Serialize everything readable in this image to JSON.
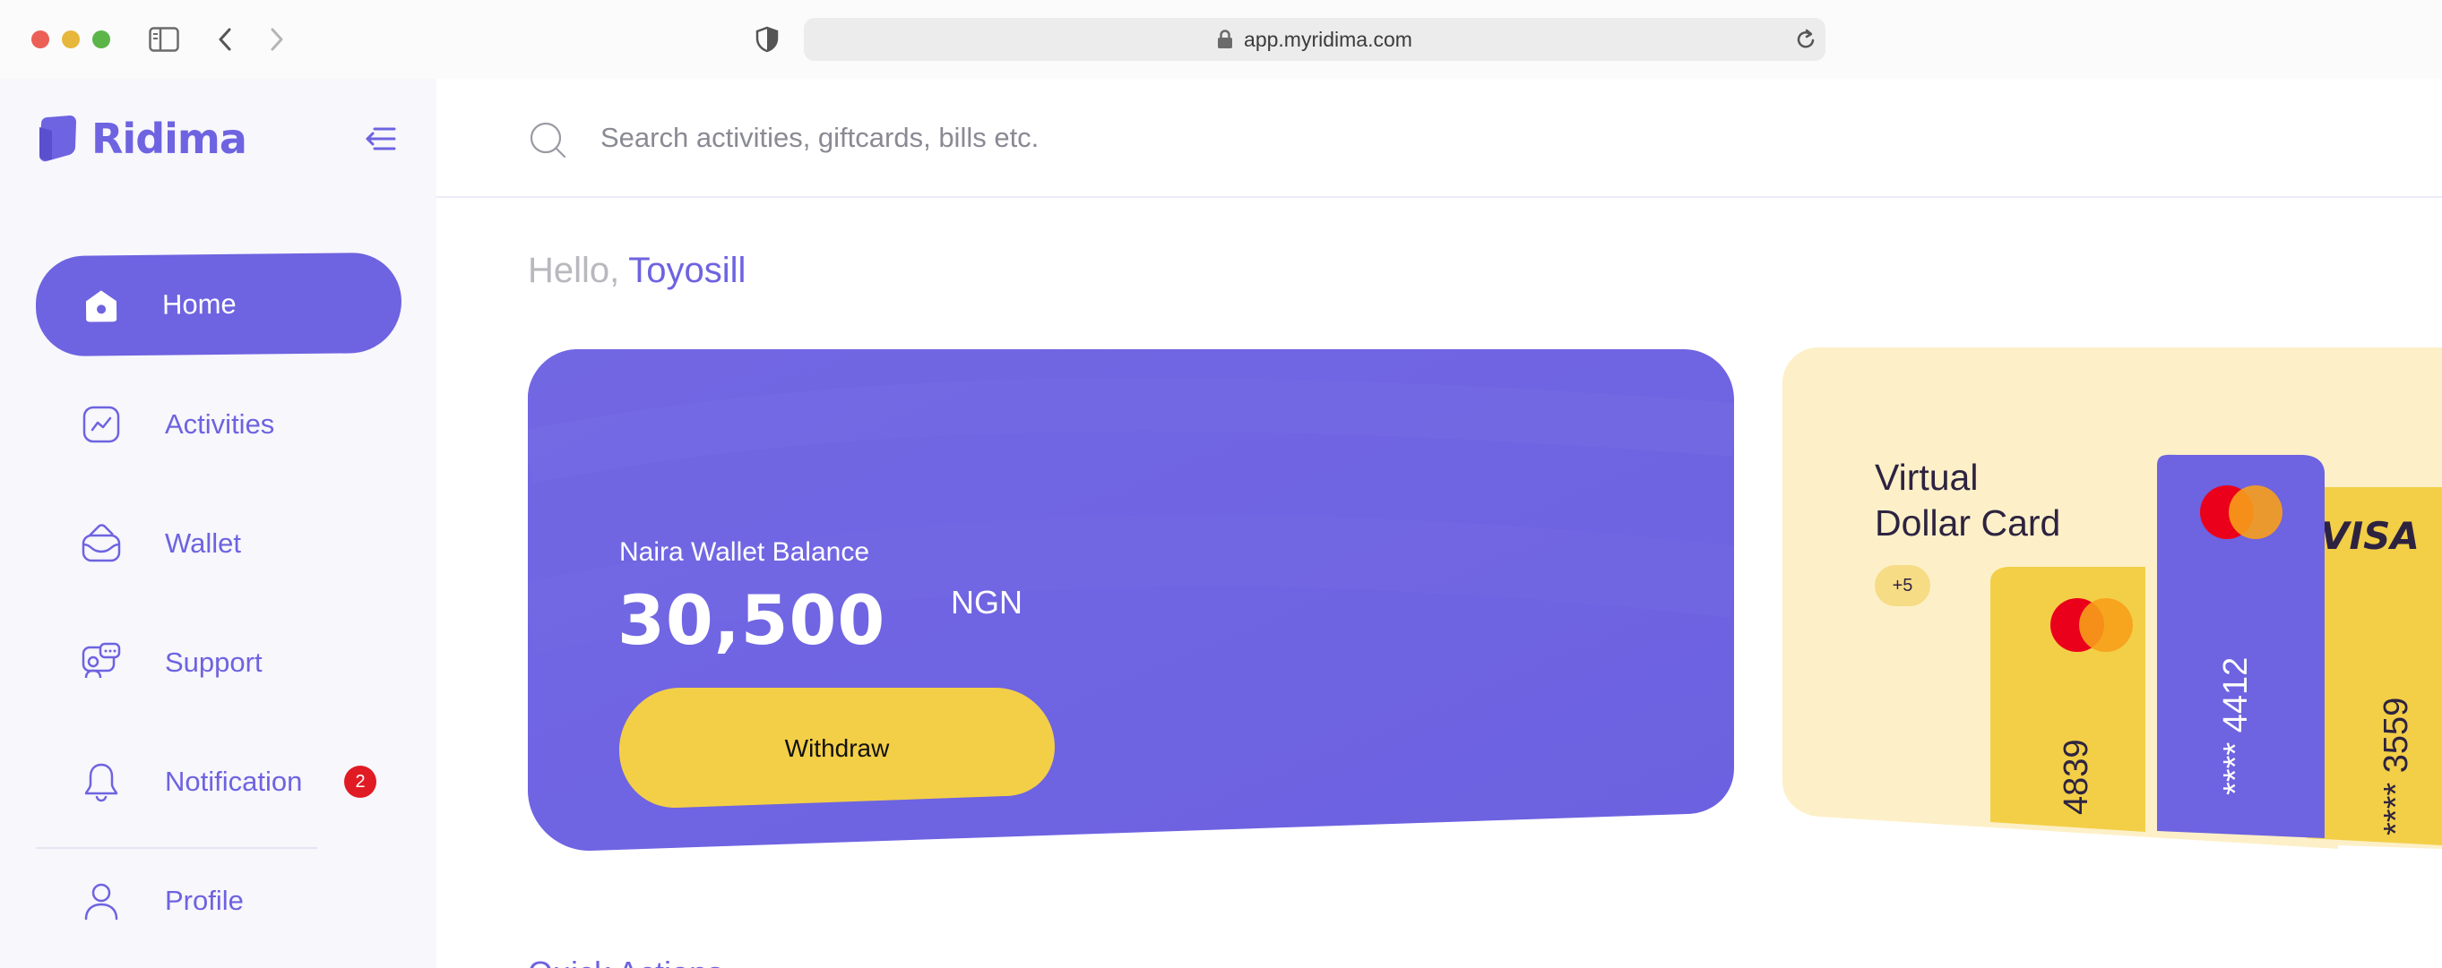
{
  "browser": {
    "url": "app.myridima.com"
  },
  "app": {
    "name": "Ridima",
    "accent": "#6e63e0",
    "yellow": "#f3cf47"
  },
  "sidebar": {
    "items": [
      {
        "label": "Home",
        "icon": "home-icon",
        "active": true
      },
      {
        "label": "Activities",
        "icon": "activity-chart-icon"
      },
      {
        "label": "Wallet",
        "icon": "wallet-icon"
      },
      {
        "label": "Support",
        "icon": "support-chat-icon"
      },
      {
        "label": "Notification",
        "icon": "bell-icon",
        "badge": "2"
      },
      {
        "label": "Profile",
        "icon": "user-icon"
      }
    ]
  },
  "search": {
    "placeholder": "Search activities, giftcards, bills etc."
  },
  "greeting": {
    "hello": "Hello,",
    "name": "Toyosill"
  },
  "wallet": {
    "title": "Naira Wallet Balance",
    "amount": "30,500",
    "currency": "NGN",
    "withdraw_label": "Withdraw"
  },
  "virtual_card": {
    "title_line1": "Virtual",
    "title_line2": "Dollar Card",
    "more_badge": "+5",
    "cards": [
      {
        "number": "4839",
        "brand": "mastercard",
        "color": "#f3cf47"
      },
      {
        "number": "**** 4412",
        "brand": "mastercard",
        "color": "#6e63e0"
      },
      {
        "number": "**** 3559",
        "brand": "VISA",
        "color": "#f3cf47"
      }
    ]
  },
  "quick_actions": {
    "title": "Quick Actions"
  }
}
